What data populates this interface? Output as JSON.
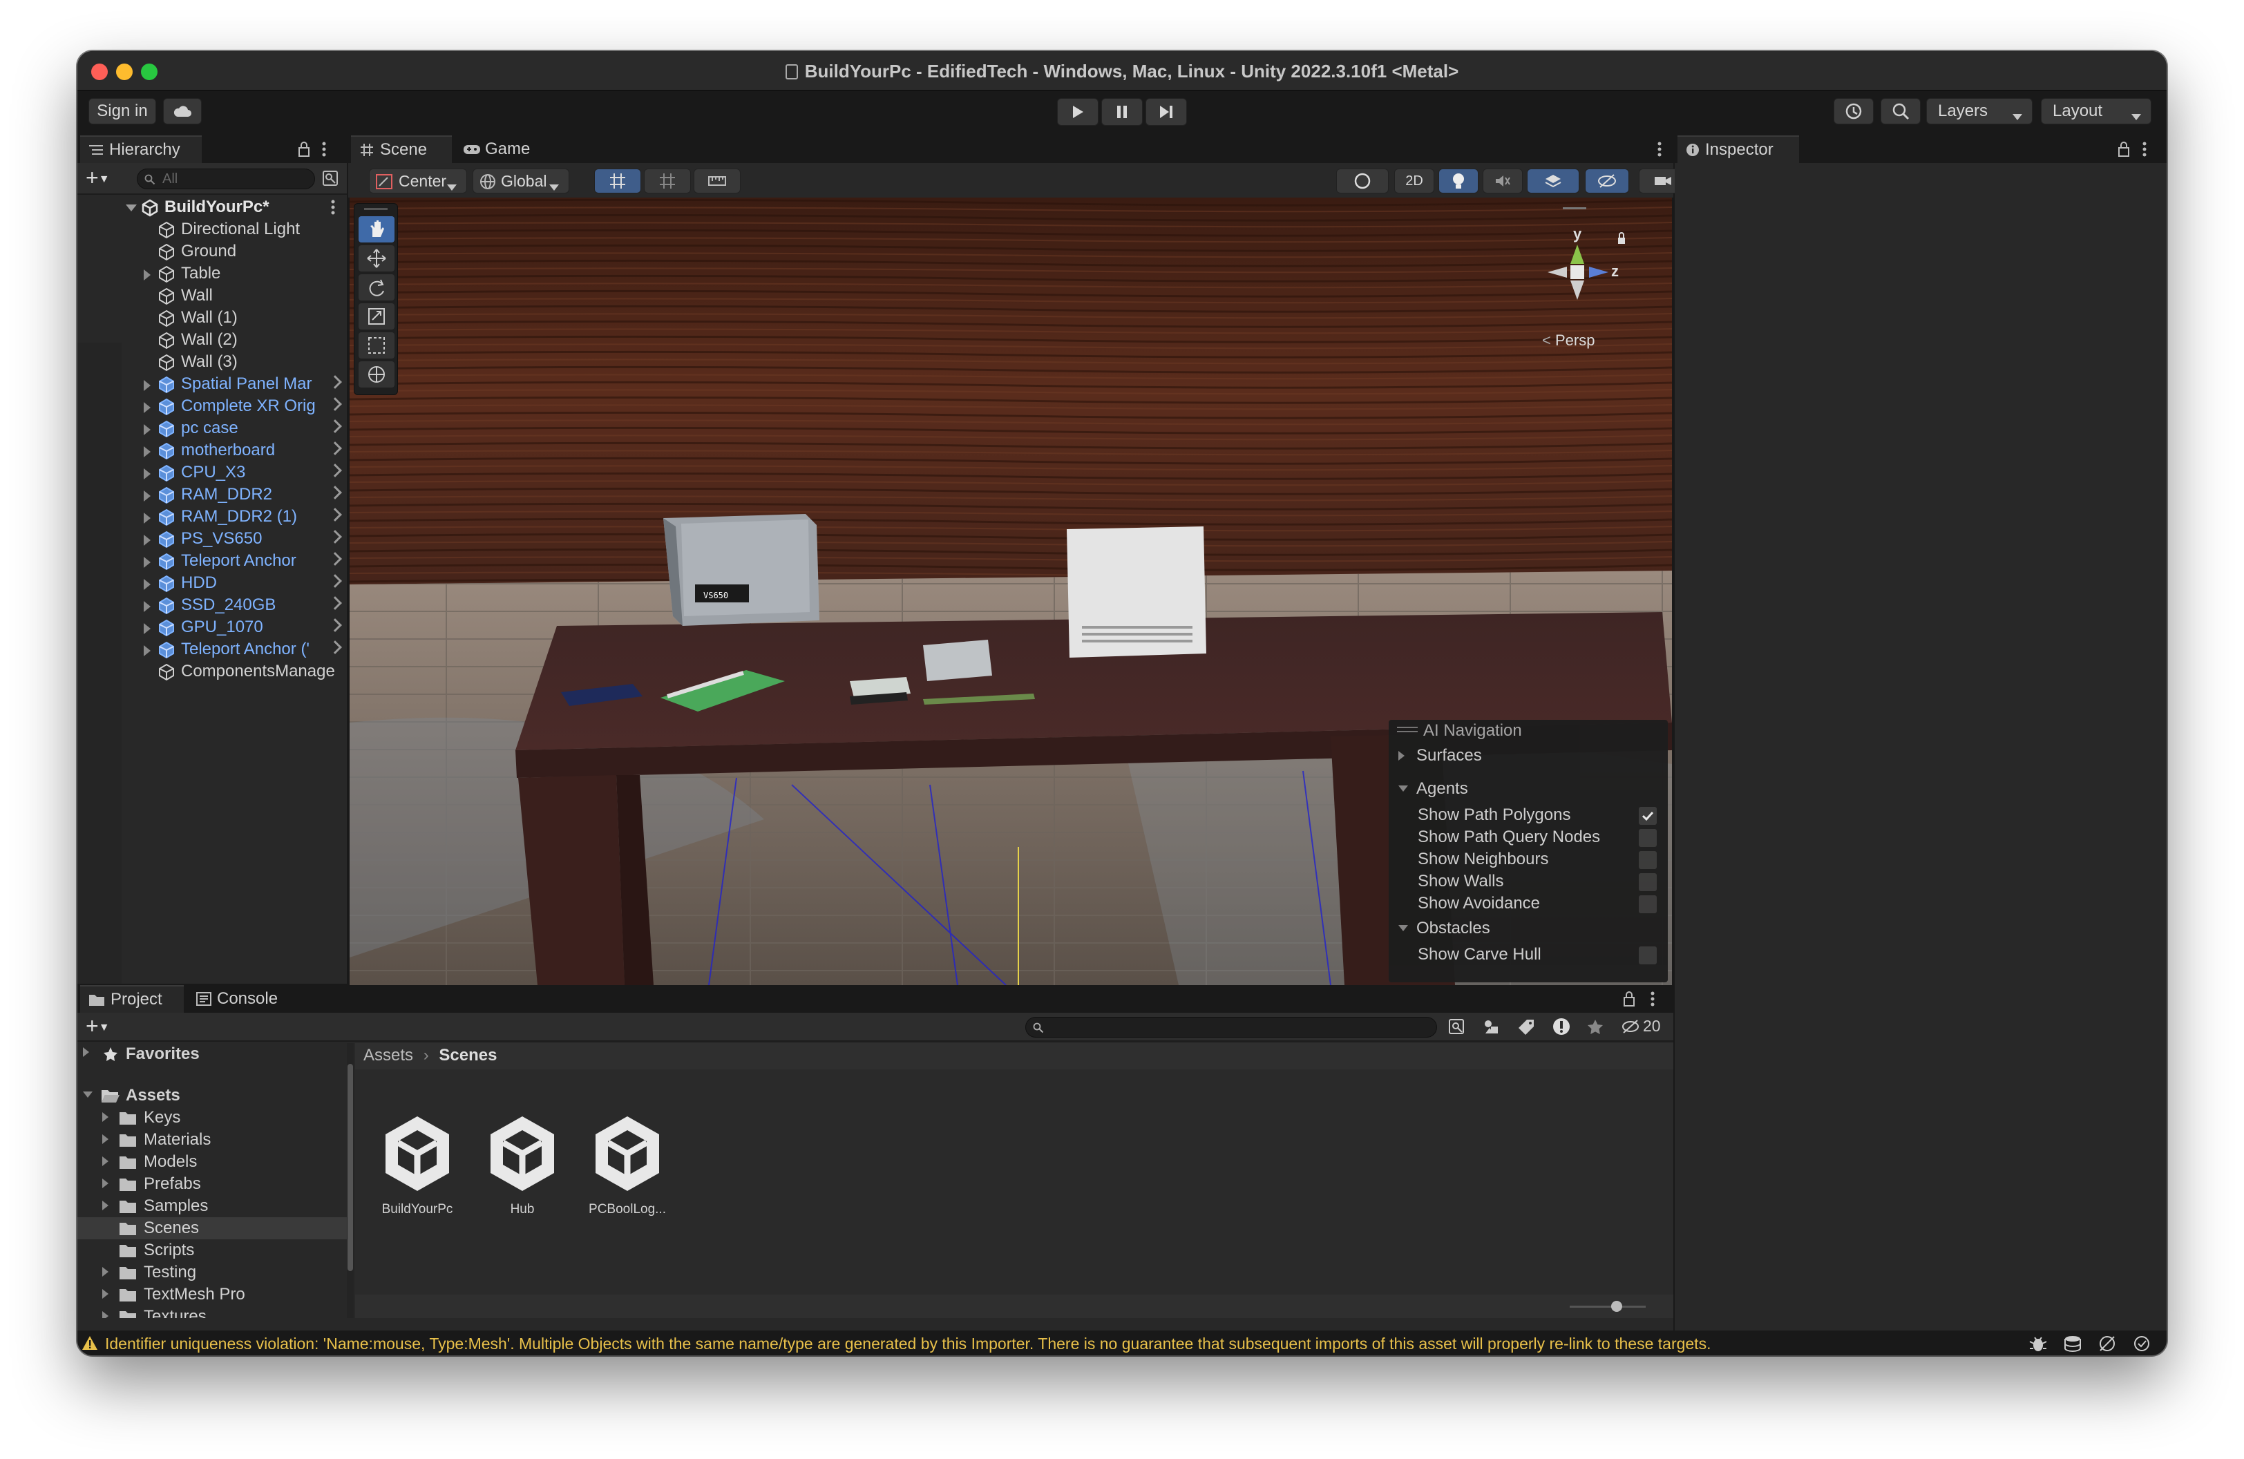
{
  "window": {
    "title": "BuildYourPc - EdifiedTech - Windows, Mac, Linux - Unity 2022.3.10f1 <Metal>"
  },
  "toolbar": {
    "sign_in": "Sign in",
    "layers": "Layers",
    "layout": "Layout"
  },
  "hierarchy": {
    "tab": "Hierarchy",
    "search_placeholder": "All",
    "root": "BuildYourPc*",
    "items": [
      {
        "label": "Directional Light",
        "prefab": false,
        "expandable": false,
        "overridden": false
      },
      {
        "label": "Ground",
        "prefab": false,
        "expandable": false,
        "overridden": false
      },
      {
        "label": "Table",
        "prefab": false,
        "expandable": true,
        "overridden": false
      },
      {
        "label": "Wall",
        "prefab": false,
        "expandable": false,
        "overridden": false
      },
      {
        "label": "Wall (1)",
        "prefab": false,
        "expandable": false,
        "overridden": false
      },
      {
        "label": "Wall (2)",
        "prefab": false,
        "expandable": false,
        "overridden": false
      },
      {
        "label": "Wall (3)",
        "prefab": false,
        "expandable": false,
        "overridden": false
      },
      {
        "label": "Spatial Panel Mar",
        "prefab": true,
        "expandable": true,
        "overridden": true
      },
      {
        "label": "Complete XR Orig",
        "prefab": true,
        "expandable": true,
        "overridden": false
      },
      {
        "label": "pc case",
        "prefab": true,
        "expandable": true,
        "overridden": true
      },
      {
        "label": "motherboard",
        "prefab": true,
        "expandable": true,
        "overridden": false
      },
      {
        "label": "CPU_X3",
        "prefab": true,
        "expandable": true,
        "overridden": false
      },
      {
        "label": "RAM_DDR2",
        "prefab": true,
        "expandable": true,
        "overridden": false
      },
      {
        "label": "RAM_DDR2 (1)",
        "prefab": true,
        "expandable": true,
        "overridden": false
      },
      {
        "label": "PS_VS650",
        "prefab": true,
        "expandable": true,
        "overridden": false
      },
      {
        "label": "Teleport Anchor",
        "prefab": true,
        "expandable": true,
        "overridden": true
      },
      {
        "label": "HDD",
        "prefab": true,
        "expandable": true,
        "overridden": false
      },
      {
        "label": "SSD_240GB",
        "prefab": true,
        "expandable": true,
        "overridden": false
      },
      {
        "label": "GPU_1070",
        "prefab": true,
        "expandable": true,
        "overridden": false
      },
      {
        "label": "Teleport Anchor ('",
        "prefab": true,
        "expandable": true,
        "overridden": false
      },
      {
        "label": "ComponentsManage",
        "prefab": false,
        "expandable": false,
        "overridden": false
      }
    ]
  },
  "scene": {
    "tab_scene": "Scene",
    "tab_game": "Game",
    "pivot": "Center",
    "space": "Global",
    "mode_2d": "2D",
    "gizmo_y": "y",
    "gizmo_z": "z",
    "persp": "Persp",
    "psu_label": "VS650",
    "ai_nav": {
      "title": "AI Navigation",
      "surfaces": "Surfaces",
      "agents": "Agents",
      "agent_options": [
        {
          "label": "Show Path Polygons",
          "checked": true
        },
        {
          "label": "Show Path Query Nodes",
          "checked": false
        },
        {
          "label": "Show Neighbours",
          "checked": false
        },
        {
          "label": "Show Walls",
          "checked": false
        },
        {
          "label": "Show Avoidance",
          "checked": false
        }
      ],
      "obstacles": "Obstacles",
      "obstacle_options": [
        {
          "label": "Show Carve Hull",
          "checked": false
        }
      ]
    }
  },
  "inspector": {
    "tab": "Inspector"
  },
  "project": {
    "tab_project": "Project",
    "tab_console": "Console",
    "hidden_count": "20",
    "favorites": "Favorites",
    "assets": "Assets",
    "folders": [
      "Keys",
      "Materials",
      "Models",
      "Prefabs",
      "Samples",
      "Scenes",
      "Scripts",
      "Testing",
      "TextMesh Pro",
      "Textures"
    ],
    "selected_folder": "Scenes",
    "breadcrumb": [
      "Assets",
      "Scenes"
    ],
    "files": [
      "BuildYourPc",
      "Hub",
      "PCBoolLog..."
    ]
  },
  "status": {
    "message": "Identifier uniqueness violation: 'Name:mouse, Type:Mesh'. Multiple Objects with the same name/type are generated by this Importer. There is no guarantee that subsequent imports of this asset will properly re-link to these targets."
  },
  "colors": {
    "accent": "#3f6aa8",
    "prefab_text": "#7fb3ff",
    "warning": "#e8c04a",
    "panel": "#282828"
  }
}
